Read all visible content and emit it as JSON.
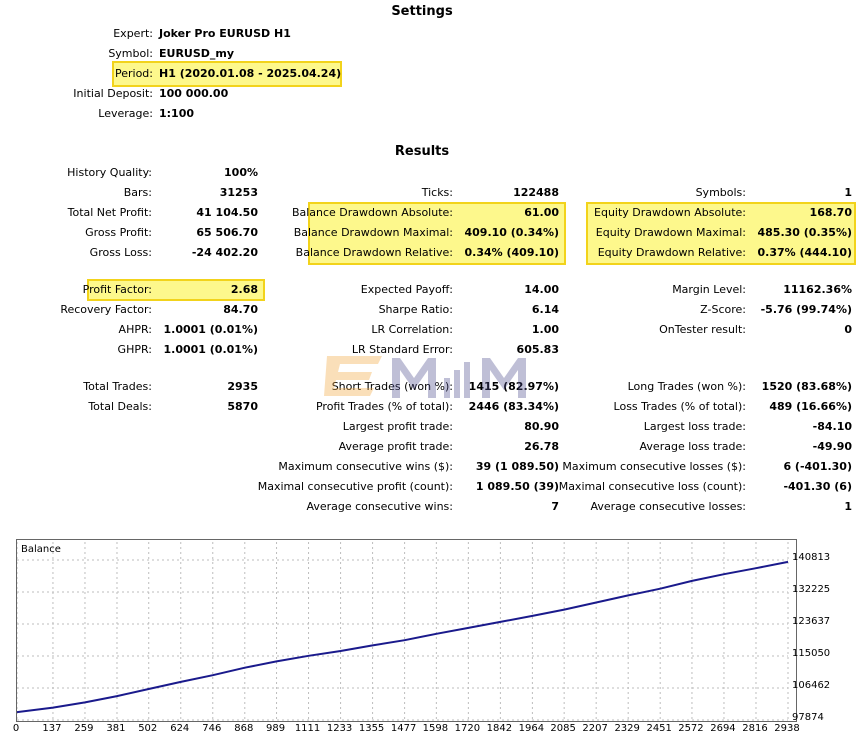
{
  "settings": {
    "title": "Settings",
    "rows": [
      {
        "label": "Expert:",
        "value": "Joker Pro EURUSD H1"
      },
      {
        "label": "Symbol:",
        "value": "EURUSD_my"
      },
      {
        "label": "Period:",
        "value": "H1 (2020.01.08 - 2025.04.24)"
      },
      {
        "label": "Initial Deposit:",
        "value": "100 000.00"
      },
      {
        "label": "Leverage:",
        "value": "1:100"
      }
    ]
  },
  "results": {
    "title": "Results",
    "col1": [
      {
        "label": "History Quality:",
        "value": "100%"
      },
      {
        "label": "Bars:",
        "value": "31253"
      },
      {
        "label": "Total Net Profit:",
        "value": "41 104.50"
      },
      {
        "label": "Gross Profit:",
        "value": "65 506.70"
      },
      {
        "label": "Gross Loss:",
        "value": "-24 402.20"
      },
      {
        "label": "Profit Factor:",
        "value": "2.68"
      },
      {
        "label": "Recovery Factor:",
        "value": "84.70"
      },
      {
        "label": "AHPR:",
        "value": "1.0001 (0.01%)"
      },
      {
        "label": "GHPR:",
        "value": "1.0001 (0.01%)"
      },
      {
        "label": "Total Trades:",
        "value": "2935"
      },
      {
        "label": "Total Deals:",
        "value": "5870"
      }
    ],
    "col2": [
      {
        "label": "Ticks:",
        "value": "122488"
      },
      {
        "label": "Balance Drawdown Absolute:",
        "value": "61.00"
      },
      {
        "label": "Balance Drawdown Maximal:",
        "value": "409.10 (0.34%)"
      },
      {
        "label": "Balance Drawdown Relative:",
        "value": "0.34% (409.10)"
      },
      {
        "label": "Expected Payoff:",
        "value": "14.00"
      },
      {
        "label": "Sharpe Ratio:",
        "value": "6.14"
      },
      {
        "label": "LR Correlation:",
        "value": "1.00"
      },
      {
        "label": "LR Standard Error:",
        "value": "605.83"
      },
      {
        "label": "Short Trades (won %):",
        "value": "1415 (82.97%)"
      },
      {
        "label": "Profit Trades (% of total):",
        "value": "2446 (83.34%)"
      },
      {
        "label": "Largest profit trade:",
        "value": "80.90"
      },
      {
        "label": "Average profit trade:",
        "value": "26.78"
      },
      {
        "label": "Maximum consecutive wins ($):",
        "value": "39 (1 089.50)"
      },
      {
        "label": "Maximal consecutive profit (count):",
        "value": "1 089.50 (39)"
      },
      {
        "label": "Average consecutive wins:",
        "value": "7"
      }
    ],
    "col3": [
      {
        "label": "Symbols:",
        "value": "1"
      },
      {
        "label": "Equity Drawdown Absolute:",
        "value": "168.70"
      },
      {
        "label": "Equity Drawdown Maximal:",
        "value": "485.30 (0.35%)"
      },
      {
        "label": "Equity Drawdown Relative:",
        "value": "0.37% (444.10)"
      },
      {
        "label": "Margin Level:",
        "value": "11162.36%"
      },
      {
        "label": "Z-Score:",
        "value": "-5.76 (99.74%)"
      },
      {
        "label": "OnTester result:",
        "value": "0"
      },
      {
        "label": "Long Trades (won %):",
        "value": "1520 (83.68%)"
      },
      {
        "label": "Loss Trades (% of total):",
        "value": "489 (16.66%)"
      },
      {
        "label": "Largest loss trade:",
        "value": "-84.10"
      },
      {
        "label": "Average loss trade:",
        "value": "-49.90"
      },
      {
        "label": "Maximum consecutive losses ($):",
        "value": "6 (-401.30)"
      },
      {
        "label": "Maximal consecutive loss (count):",
        "value": "-401.30 (6)"
      },
      {
        "label": "Average consecutive losses:",
        "value": "1"
      }
    ]
  },
  "colors": {
    "highlight": "#fdf88c",
    "highlight_border": "#f2d31b",
    "line": "#1a1a8c",
    "grid": "#bdbdbd"
  },
  "chart_data": {
    "type": "line",
    "title": "Balance",
    "xlabel": "",
    "ylabel": "",
    "x_ticks": [
      "0",
      "137",
      "259",
      "381",
      "502",
      "624",
      "746",
      "868",
      "989",
      "1111",
      "1233",
      "1355",
      "1477",
      "1598",
      "1720",
      "1842",
      "1964",
      "2085",
      "2207",
      "2329",
      "2451",
      "2572",
      "2694",
      "2816",
      "2938"
    ],
    "y_ticks": [
      "140813",
      "132225",
      "123637",
      "115050",
      "106462",
      "97874"
    ],
    "ylim": [
      97874,
      140813
    ],
    "xlim": [
      0,
      2938
    ],
    "series": [
      {
        "x": [
          0,
          137,
          259,
          381,
          502,
          624,
          746,
          868,
          989,
          1111,
          1233,
          1355,
          1477,
          1598,
          1720,
          1842,
          1964,
          2085,
          2207,
          2329,
          2451,
          2572,
          2694,
          2816,
          2938
        ],
        "values": [
          100000,
          101200,
          102600,
          104300,
          106200,
          108100,
          109900,
          111900,
          113600,
          115100,
          116400,
          117900,
          119300,
          121000,
          122600,
          124200,
          125800,
          127500,
          129400,
          131300,
          133100,
          135200,
          137000,
          138600,
          140300
        ]
      }
    ]
  }
}
